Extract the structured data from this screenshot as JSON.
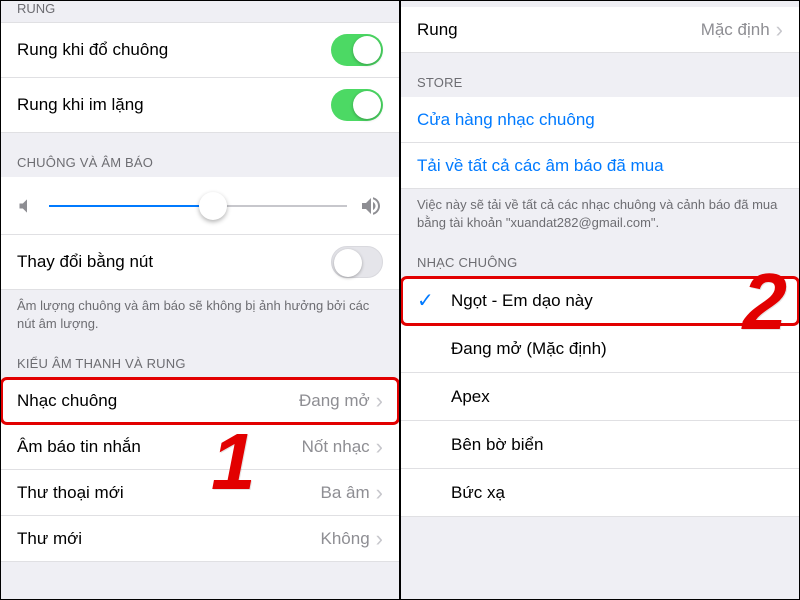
{
  "left": {
    "cut_header": "RUNG",
    "vibrate_ring": "Rung khi đổ chuông",
    "vibrate_silent": "Rung khi im lặng",
    "section_ringer": "CHUÔNG VÀ ÂM BÁO",
    "slider_value": 55,
    "change_with_buttons": "Thay đổi bằng nút",
    "volume_footer": "Âm lượng chuông và âm báo sẽ không bị ảnh hưởng bởi các nút âm lượng.",
    "section_sounds": "KIỂU ÂM THANH VÀ RUNG",
    "rows": [
      {
        "label": "Nhạc chuông",
        "value": "Đang mở"
      },
      {
        "label": "Âm báo tin nhắn",
        "value": "Nốt nhạc"
      },
      {
        "label": "Thư thoại mới",
        "value": "Ba âm"
      },
      {
        "label": "Thư mới",
        "value": "Không"
      }
    ]
  },
  "right": {
    "vibration_label": "Rung",
    "vibration_value": "Mặc định",
    "section_store": "STORE",
    "store_link": "Cửa hàng nhạc chuông",
    "download_link": "Tải về tất cả các âm báo đã mua",
    "store_footer": "Việc này sẽ tải về tất cả các nhạc chuông và cảnh báo đã mua bằng tài khoản \"xuandat282@gmail.com\".",
    "section_ringtone": "NHẠC CHUÔNG",
    "tones": [
      {
        "label": "Ngọt - Em dạo này",
        "checked": true
      },
      {
        "label": "Đang mở (Mặc định)",
        "checked": false
      },
      {
        "label": "Apex",
        "checked": false
      },
      {
        "label": "Bên bờ biển",
        "checked": false
      },
      {
        "label": "Bức xạ",
        "checked": false
      }
    ]
  },
  "annot": {
    "one": "1",
    "two": "2"
  }
}
